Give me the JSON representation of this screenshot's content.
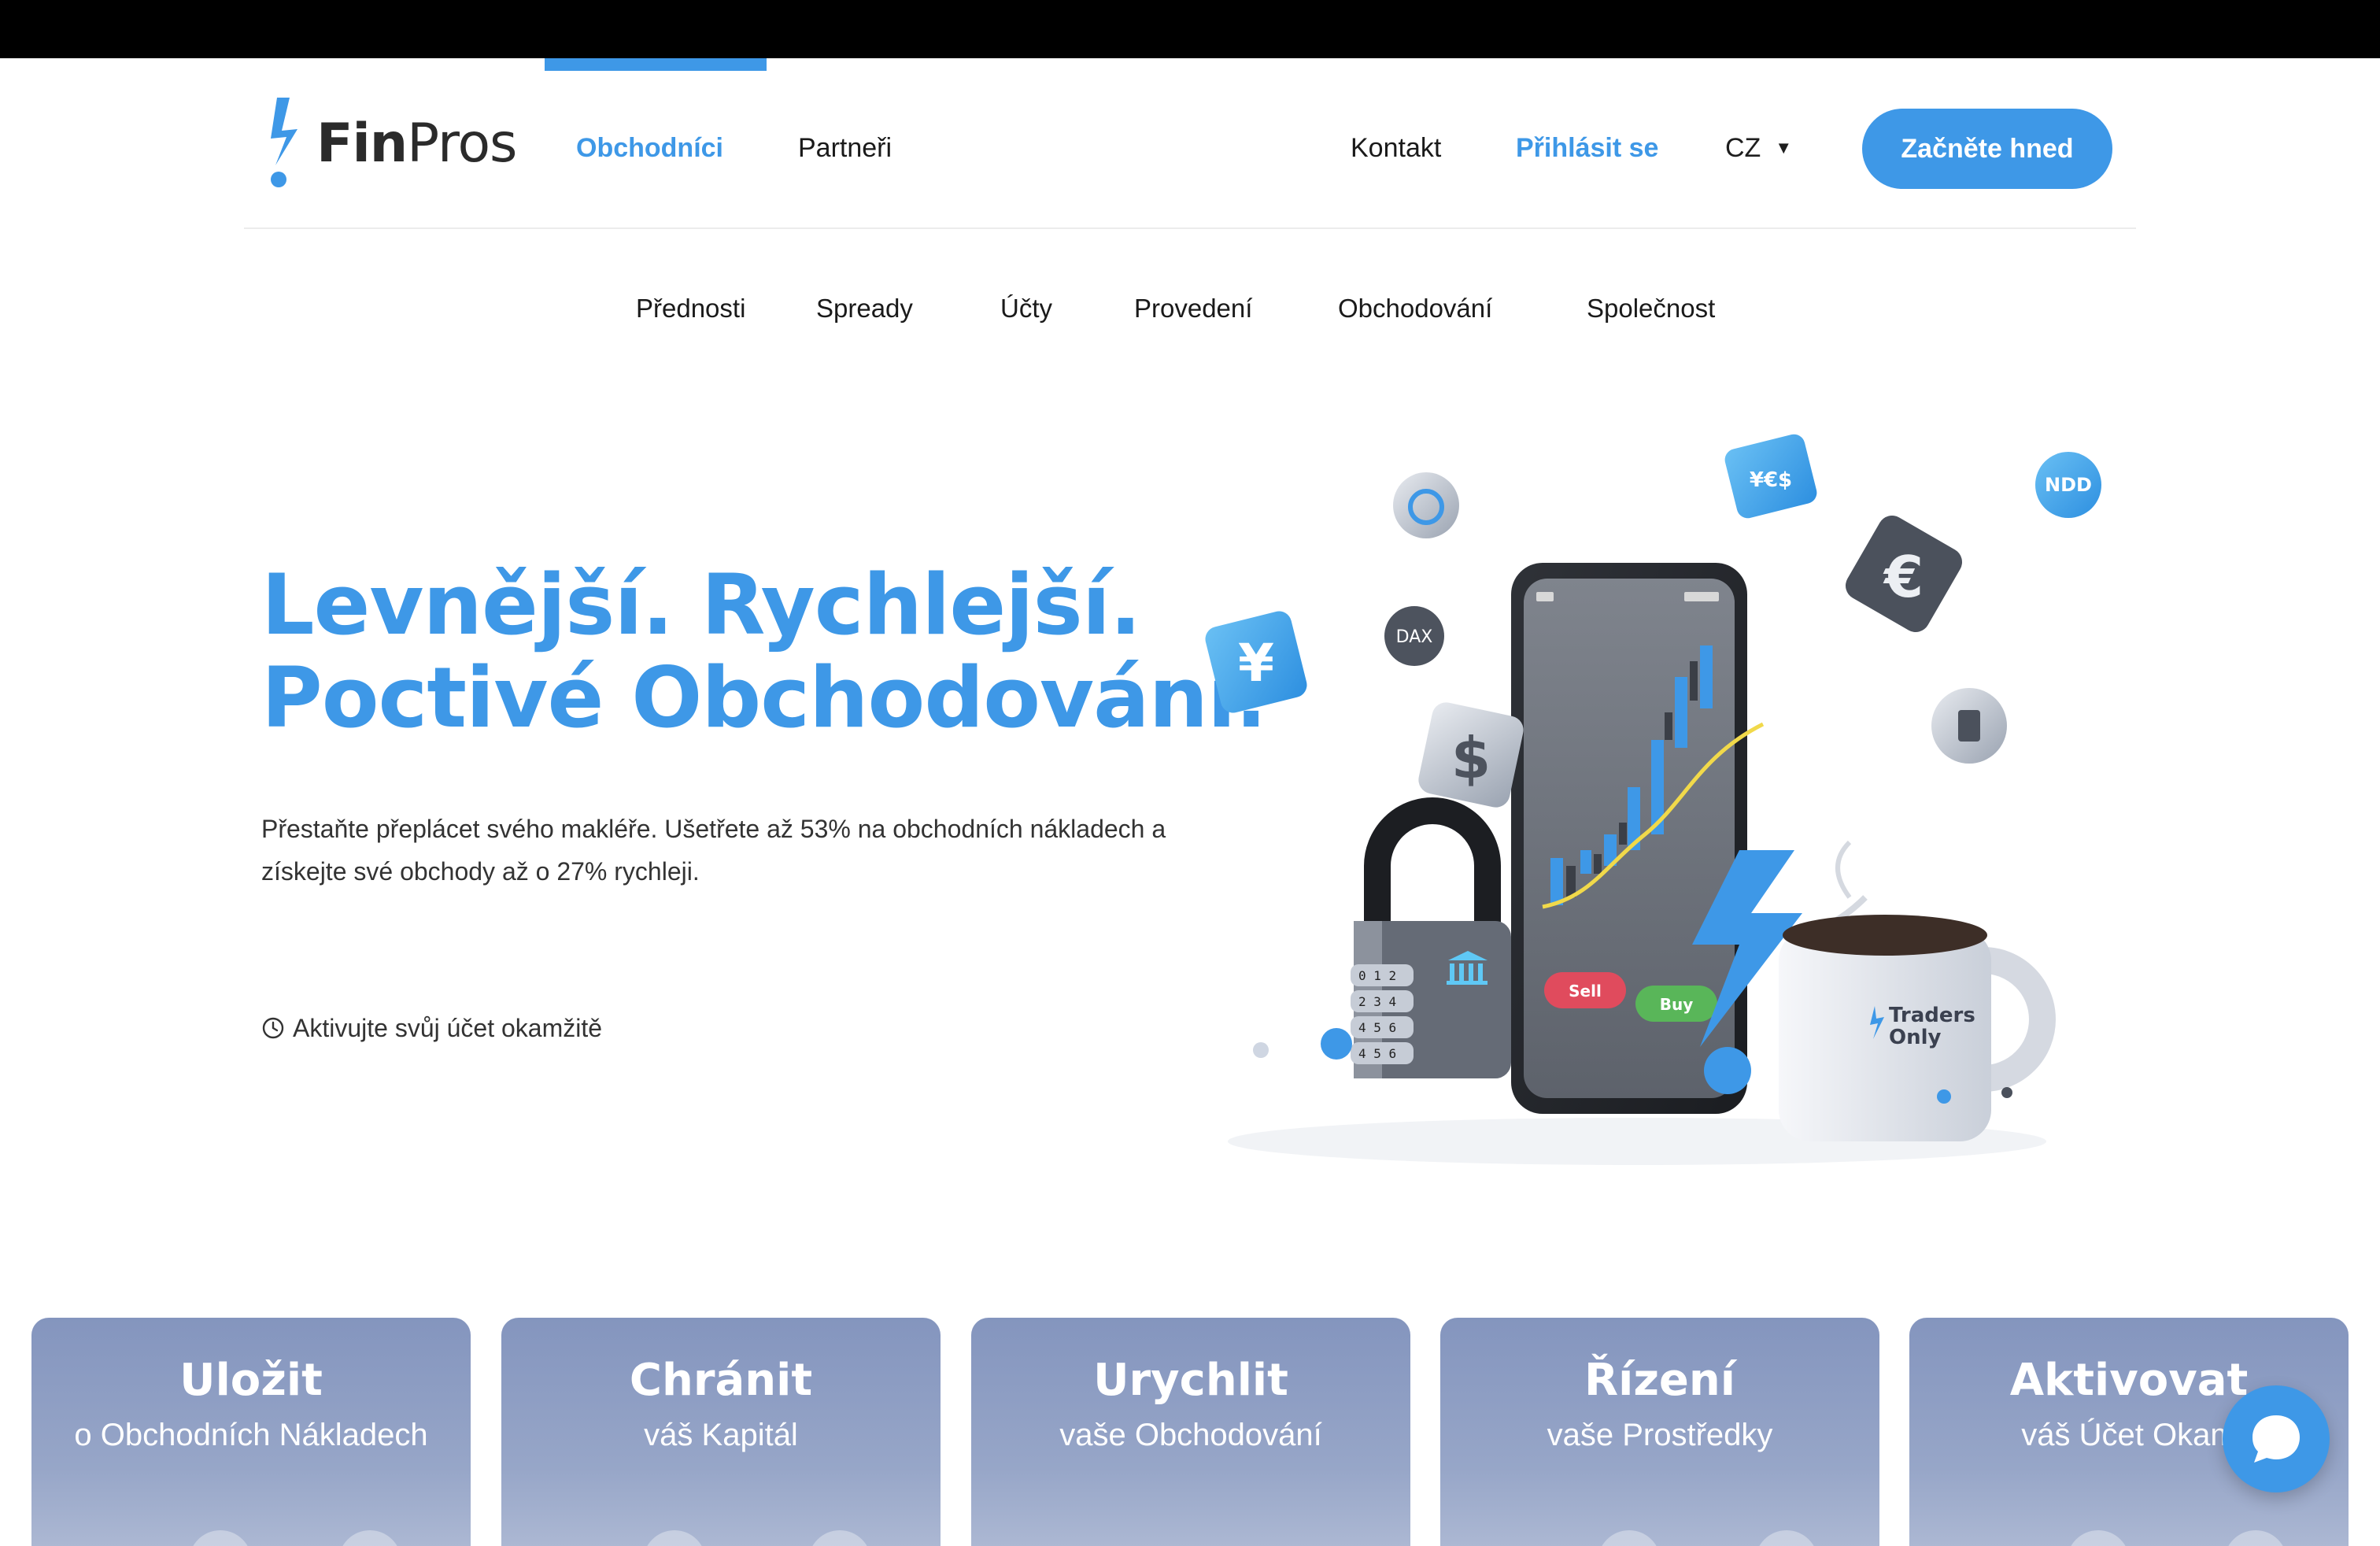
{
  "brand": {
    "name_bold": "Fin",
    "name_light": "Pros",
    "accent": "#3e98e7"
  },
  "nav": {
    "left": [
      {
        "label": "Obchodníci",
        "active": true
      },
      {
        "label": "Partneři",
        "active": false
      }
    ],
    "contact": "Kontakt",
    "login": "Přihlásit se",
    "language": "CZ",
    "cta": "Začněte hned"
  },
  "subnav": [
    "Přednosti",
    "Spready",
    "Účty",
    "Provedení",
    "Obchodování",
    "Společnost"
  ],
  "hero": {
    "title_line1": "Levnější. Rychlejší.",
    "title_line2": "Poctivé Obchodování.",
    "subtitle": "Přestaňte přeplácet svého makléře. Ušetřete až 53% na obchodních nákladech a získejte své obchody až o 27% rychleji.",
    "note": "Aktivujte svůj účet okamžitě"
  },
  "illustration": {
    "phone_sell": "Sell",
    "phone_buy": "Buy",
    "mug_text_line1": "Traders",
    "mug_text_line2": "Only",
    "token_dax": "DAX",
    "token_ndd": "NDD",
    "token_fx": "¥€$",
    "token_yen": "¥",
    "token_dollar": "$",
    "token_euro": "€",
    "lock_digits": [
      "0 1 2",
      "2 3 4",
      "4 5 6",
      "4 5 6"
    ]
  },
  "cards": [
    {
      "title": "Uložit",
      "subtitle": "o Obchodních Nákladech"
    },
    {
      "title": "Chránit",
      "subtitle": "váš Kapitál"
    },
    {
      "title": "Urychlit",
      "subtitle": "vaše Obchodování"
    },
    {
      "title": "Řízení",
      "subtitle": "vaše Prostředky"
    },
    {
      "title": "Aktivovat",
      "subtitle": "váš Účet Okam"
    }
  ]
}
